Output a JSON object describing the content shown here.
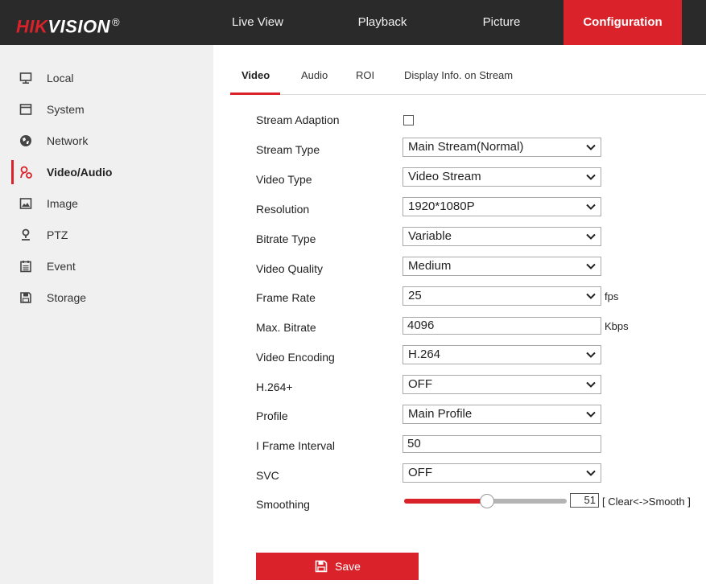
{
  "header": {
    "logo_red": "HIK",
    "logo_white": "VISION",
    "logo_reg": "®",
    "nav": [
      {
        "label": "Live View"
      },
      {
        "label": "Playback"
      },
      {
        "label": "Picture"
      },
      {
        "label": "Configuration",
        "active": true
      }
    ]
  },
  "sidebar": {
    "items": [
      {
        "label": "Local",
        "icon": "monitor-icon"
      },
      {
        "label": "System",
        "icon": "system-icon"
      },
      {
        "label": "Network",
        "icon": "globe-icon"
      },
      {
        "label": "Video/Audio",
        "icon": "video-audio-icon",
        "active": true
      },
      {
        "label": "Image",
        "icon": "image-icon"
      },
      {
        "label": "PTZ",
        "icon": "ptz-icon"
      },
      {
        "label": "Event",
        "icon": "calendar-icon"
      },
      {
        "label": "Storage",
        "icon": "floppy-icon"
      }
    ]
  },
  "tabs": [
    {
      "label": "Video",
      "active": true
    },
    {
      "label": "Audio"
    },
    {
      "label": "ROI"
    },
    {
      "label": "Display Info. on Stream"
    }
  ],
  "form": {
    "stream_adaption": {
      "label": "Stream Adaption",
      "checked": false
    },
    "stream_type": {
      "label": "Stream Type",
      "value": "Main Stream(Normal)"
    },
    "video_type": {
      "label": "Video Type",
      "value": "Video Stream"
    },
    "resolution": {
      "label": "Resolution",
      "value": "1920*1080P"
    },
    "bitrate_type": {
      "label": "Bitrate Type",
      "value": "Variable"
    },
    "video_quality": {
      "label": "Video Quality",
      "value": "Medium"
    },
    "frame_rate": {
      "label": "Frame Rate",
      "value": "25",
      "unit": "fps"
    },
    "max_bitrate": {
      "label": "Max. Bitrate",
      "value": "4096",
      "unit": "Kbps"
    },
    "video_encoding": {
      "label": "Video Encoding",
      "value": "H.264"
    },
    "h264plus": {
      "label": "H.264+",
      "value": "OFF"
    },
    "profile": {
      "label": "Profile",
      "value": "Main Profile"
    },
    "i_frame_interval": {
      "label": "I Frame Interval",
      "value": "50"
    },
    "svc": {
      "label": "SVC",
      "value": "OFF"
    },
    "smoothing": {
      "label": "Smoothing",
      "value": "51",
      "level_percent": 51,
      "hint": "[ Clear<->Smooth ]"
    }
  },
  "save_label": "Save",
  "colors": {
    "accent": "#d9222a",
    "header_bg": "#2a2a2a",
    "sidebar_bg": "#f0f0f0"
  }
}
